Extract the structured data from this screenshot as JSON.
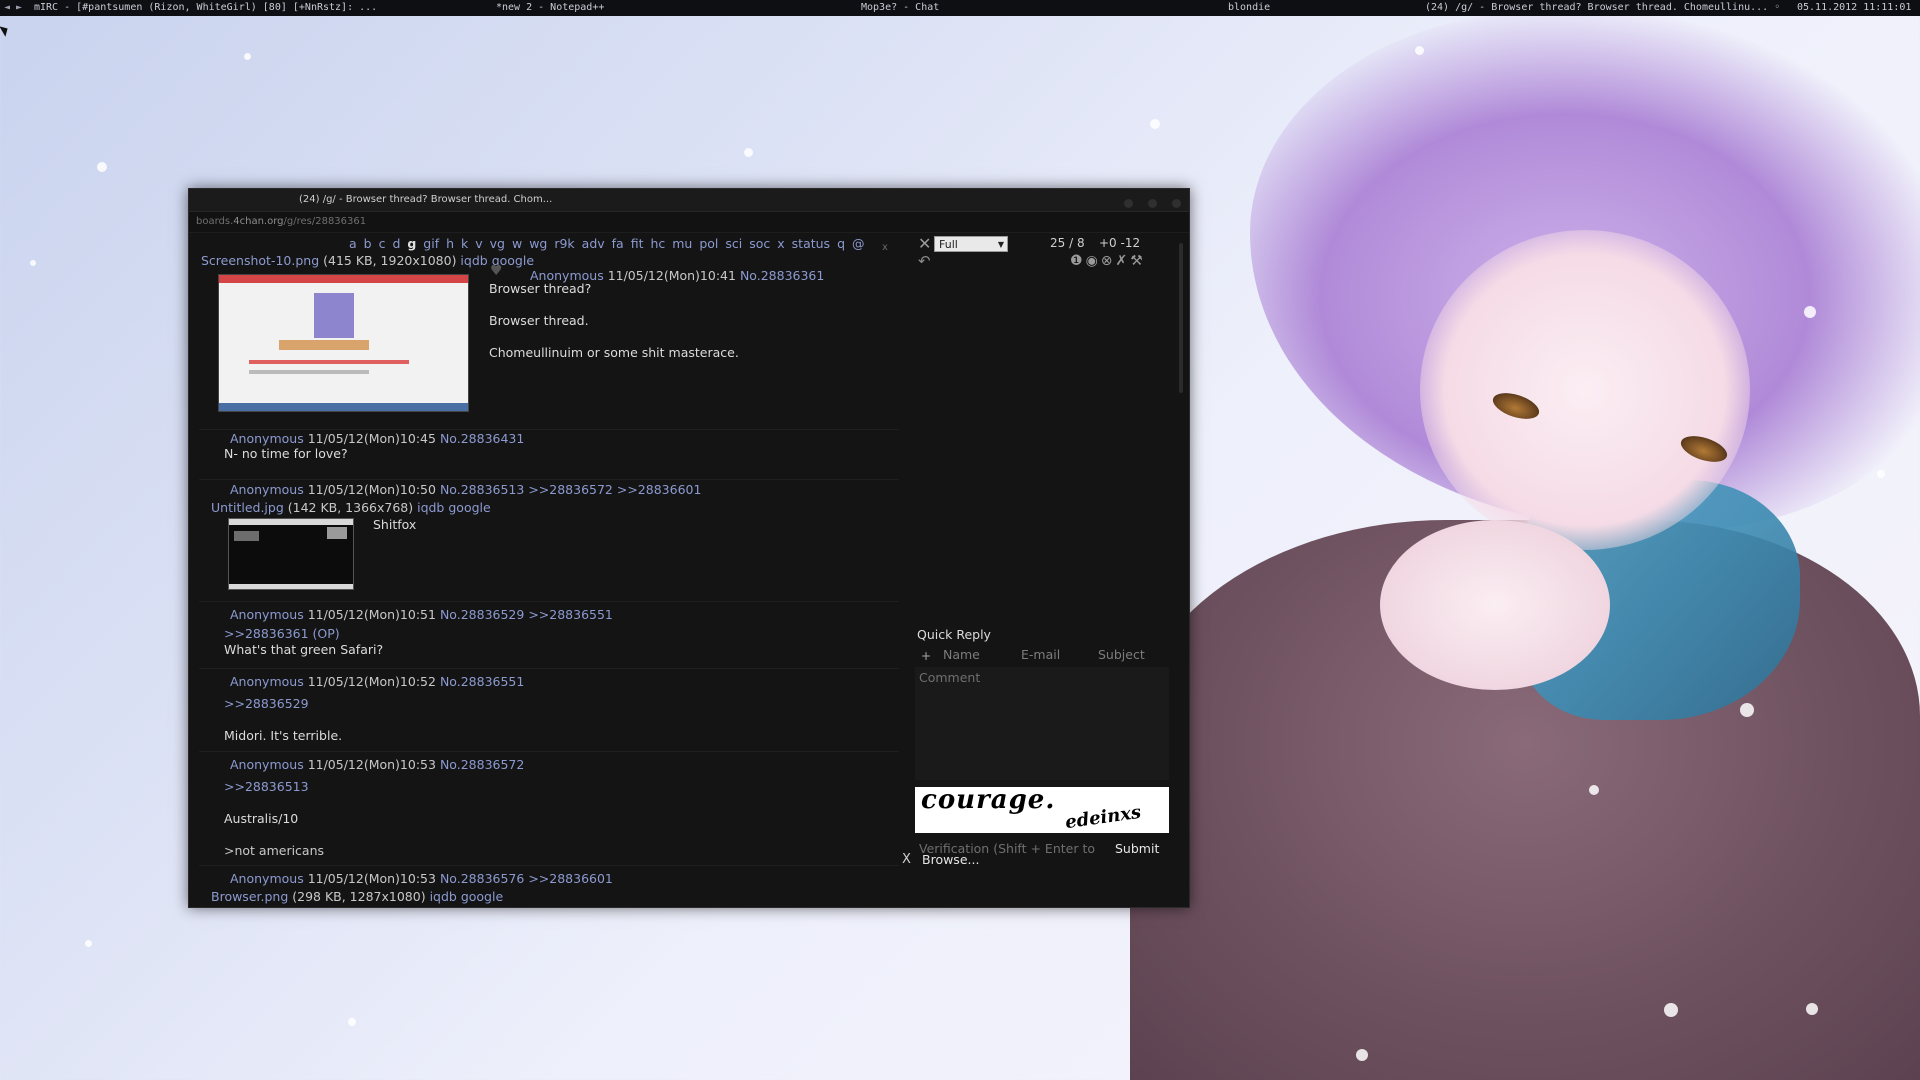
{
  "taskbar": {
    "arrows": "◄ ►",
    "items": [
      "mIRC - [#pantsumen (Rizon, WhiteGirl) [80] [+NnRstz]: ...",
      "*new  2 - Notepad++",
      "Mop3e? - Chat",
      "blondie",
      "(24) /g/ - Browser thread? Browser thread. Chomeullinu... ◦"
    ],
    "clock": "05.11.2012 11:11:01"
  },
  "browser": {
    "title": "(24) /g/ - Browser thread? Browser thread. Chom...",
    "url_host": "boards.4chan.org",
    "url_path": "/g/res/28836361"
  },
  "nav": {
    "boards": [
      "a",
      "b",
      "c",
      "d",
      "g",
      "gif",
      "h",
      "k",
      "v",
      "vg",
      "w",
      "wg",
      "r9k",
      "adv",
      "fa",
      "fit",
      "hc",
      "mu",
      "pol",
      "sci",
      "soc",
      "x",
      "status",
      "q",
      "@"
    ],
    "current": "g"
  },
  "op": {
    "file_name": "Screenshot-10.png",
    "file_meta": " (415 KB, 1920x1080) ",
    "iqdb": "iqdb",
    "google": "google",
    "name": "Anonymous",
    "date": "11/05/12(Mon)10:41",
    "no": "No.28836361",
    "lines": [
      "Browser thread?",
      "Browser thread.",
      "Chomeullinuim or some shit masterace."
    ]
  },
  "posts": [
    {
      "name": "Anonymous",
      "date": "11/05/12(Mon)10:45",
      "no": "No.28836431",
      "refs": "",
      "body": "N- no time for love?"
    },
    {
      "name": "Anonymous",
      "date": "11/05/12(Mon)10:50",
      "no": "No.28836513",
      "refs": ">>28836572 >>28836601",
      "file_name": "Untitled.jpg",
      "file_meta": " (142 KB, 1366x768) ",
      "body": "Shitfox"
    },
    {
      "name": "Anonymous",
      "date": "11/05/12(Mon)10:51",
      "no": "No.28836529",
      "refs": ">>28836551",
      "quote": ">>28836361 (OP)",
      "body": "What's that green Safari?"
    },
    {
      "name": "Anonymous",
      "date": "11/05/12(Mon)10:52",
      "no": "No.28836551",
      "refs": "",
      "quote": ">>28836529",
      "body": "Midori. It's terrible."
    },
    {
      "name": "Anonymous",
      "date": "11/05/12(Mon)10:53",
      "no": "No.28836572",
      "refs": "",
      "quote": ">>28836513",
      "body": "Australis/10",
      "greentext": ">not americans"
    },
    {
      "name": "Anonymous",
      "date": "11/05/12(Mon)10:53",
      "no": "No.28836576",
      "refs": ">>28836601",
      "file_name": "Browser.png",
      "file_meta": " (298 KB, 1287x1080) "
    }
  ],
  "close_x": "x",
  "panel": {
    "mode": "Full",
    "page_count": "25 / 8",
    "diff": "+0 -12"
  },
  "quick_reply": {
    "title": "Quick Reply",
    "plus": "+",
    "name_ph": "Name",
    "email_ph": "E-mail",
    "subject_ph": "Subject",
    "comment_ph": "Comment",
    "captcha_word1": "courage.",
    "captcha_word2": "edeinxs",
    "verification_ph": "Verification (Shift + Enter to ca",
    "submit": "Submit",
    "x": "X",
    "browse": "Browse..."
  },
  "colors": {
    "link": "#8c9ad0",
    "greentext": "#9cb86a",
    "window_bg": "#141414"
  }
}
